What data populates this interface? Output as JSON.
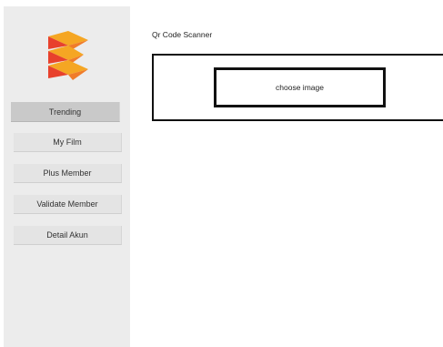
{
  "sidebar": {
    "logo_icon": "layered-hexagon-logo-icon",
    "items": [
      {
        "label": "Trending",
        "active": true
      },
      {
        "label": "My Film",
        "active": false
      },
      {
        "label": "Plus Member",
        "active": false
      },
      {
        "label": "Validate Member",
        "active": false
      },
      {
        "label": "Detail Akun",
        "active": false
      }
    ]
  },
  "main": {
    "title": "Qr Code Scanner",
    "choose_image_label": "choose image"
  },
  "colors": {
    "logo_orange": "#F5A623",
    "logo_red": "#E8412C",
    "sidebar_bg": "#ECECEC",
    "active_item_bg": "#C9C9C9"
  }
}
